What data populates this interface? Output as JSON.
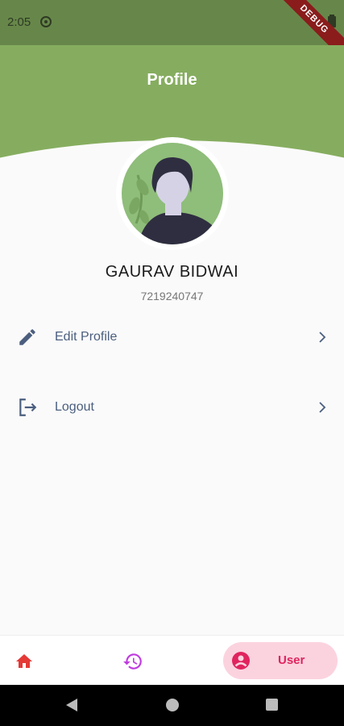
{
  "status_bar": {
    "time": "2:05",
    "debug_label": "DEBUG"
  },
  "header": {
    "title": "Profile"
  },
  "profile": {
    "name": "GAURAV BIDWAI",
    "phone": "7219240747"
  },
  "menu": [
    {
      "label": "Edit Profile",
      "icon": "pencil-icon"
    },
    {
      "label": "Logout",
      "icon": "logout-icon"
    }
  ],
  "bottom_nav": {
    "items": [
      {
        "icon": "home-icon",
        "color": "#e53935"
      },
      {
        "icon": "history-icon",
        "color": "#c03ce0"
      },
      {
        "icon": "user-icon",
        "label": "User",
        "color": "#e0245e",
        "selected": true
      }
    ]
  },
  "colors": {
    "accent": "#86ad5f",
    "status_bar": "#67874a",
    "menu_text": "#4b5e7e"
  }
}
